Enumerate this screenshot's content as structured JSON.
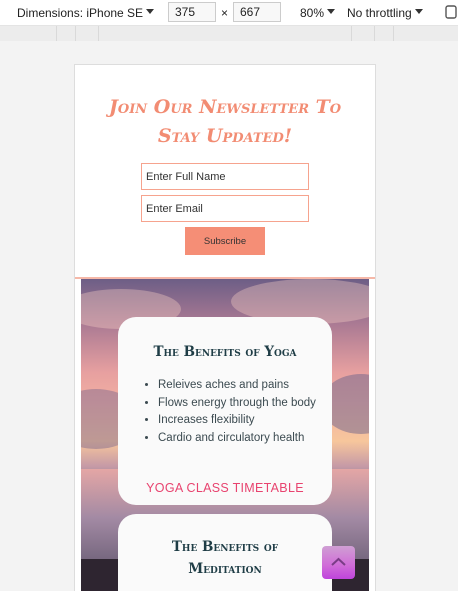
{
  "devtools": {
    "dimensions_label": "Dimensions: iPhone SE",
    "width": "375",
    "times": "×",
    "height": "667",
    "zoom": "80%",
    "throttling": "No throttling"
  },
  "newsletter": {
    "title_line1": "Join Our Newsletter To",
    "title_line2": "Stay Updated!",
    "name_placeholder": "Enter Full Name",
    "email_placeholder": "Enter Email",
    "subscribe_label": "Subscribe",
    "accent_color": "#f28c73"
  },
  "yoga_card": {
    "title": "The Benefits of Yoga",
    "benefits": [
      "Releives aches and pains",
      "Flows energy through the body",
      "Increases flexibility",
      "Cardio and circulatory health"
    ],
    "link_label": "YOGA CLASS TIMETABLE",
    "link_color": "#e8436f"
  },
  "meditation_card": {
    "title_line1": "The Benefits of",
    "title_line2": "Meditation"
  },
  "scroll_button": {
    "icon": "chevron-up-icon"
  }
}
